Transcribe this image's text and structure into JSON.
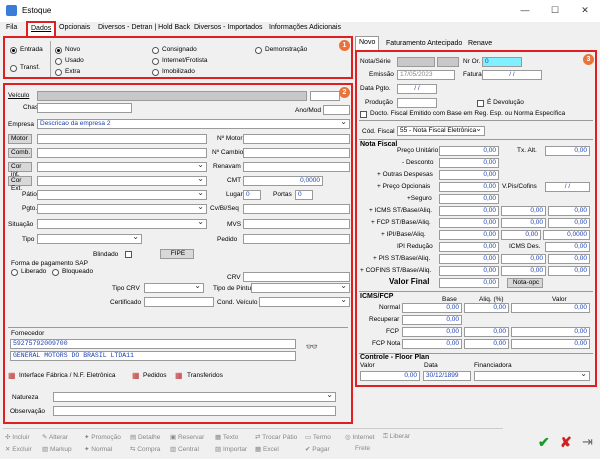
{
  "window": {
    "title": "Estoque",
    "min": "—",
    "max": "☐",
    "close": "✕"
  },
  "tabs": [
    "Fila",
    "Dados",
    "Opcionais",
    "Diversos - Detran | Hold Back",
    "Diversos - Importados",
    "Informações Adicionais"
  ],
  "section1": {
    "badge": "1",
    "entrada": "Entrada",
    "transf": "Transf.",
    "novo": "Novo",
    "usado": "Usado",
    "extra": "Extra",
    "consignado": "Consignado",
    "internet": "Internet/Frotista",
    "imobilizado": "Imobilizado",
    "demonstracao": "Demonstração"
  },
  "section2": {
    "badge": "2",
    "veiculo": "Veículo",
    "chassi": "Chassi",
    "ano_mod": "Ano/Mod",
    "empresa": "Empresa",
    "empresa_val": "Descricao da empresa 2",
    "motor": "Motor",
    "comb": "Comb.",
    "cor_int": "Cor int.",
    "cor_ext": "Cor Ext.",
    "patio": "Pátio",
    "pgto": "Pgto.",
    "situacao": "Situação",
    "tipo": "Tipo",
    "n_motor": "Nº Motor",
    "n_cambio": "Nº Cambio",
    "renavam": "Renavam",
    "cmt": "CMT",
    "cmt_val": "0,0000",
    "lugar": "Lugar",
    "lugar_val": "0",
    "portas": "Portas",
    "portas_val": "0",
    "cv_bi_seq": "Cv/Bi/Seq",
    "mvs": "MVS",
    "pedido": "Pedido",
    "blindado": "Blindado",
    "fipe": "FIPE",
    "forma_pgto": "Forma de pagamento SAP",
    "liberado": "Liberado",
    "bloqueado": "Bloqueado",
    "crv": "CRV",
    "tipo_crv": "Tipo CRV",
    "tipo_pintura": "Tipo de Pintura",
    "certificado": "Certificado",
    "cond_veiculo": "Cond. Veículo",
    "fornecedor": "Fornecedor",
    "forn_cod": "59275792009700",
    "forn_nome": "GENERAL MOTORS DO BRASIL LTDA11",
    "int_fabrica": "Interface Fábrica / N.F. Eletrônica",
    "pedidos": "Pedidos",
    "transferidos": "Transferidos",
    "natureza": "Natureza",
    "observacao": "Observação"
  },
  "right_tabs": [
    "Novo",
    "Faturamento Antecipado",
    "Renave"
  ],
  "section3": {
    "badge": "3",
    "nota_serie": "Nota/Série",
    "nr_or": "Nr Or.",
    "nr_or_val": "0",
    "emissao": "Emissão",
    "emissao_val": "17/05/2023",
    "fatura": "Fatura",
    "fatura_val": "/ /",
    "data_pgto": "Data Pgto.",
    "data_pgto_val": "/ /",
    "producao": "Produção",
    "e_devolucao": "É Devolução",
    "docto": "Docto. Fiscal Emitido com Base em Reg. Esp. ou Norma Específica",
    "cod_fiscal": "Cód. Fiscal",
    "cod_fiscal_val": "55 - Nota Fiscal Eletrônica",
    "nota_fiscal": "Nota Fiscal",
    "preco_unit": "Preço Unitário",
    "desconto": "- Desconto",
    "outras": "+ Outras Despesas",
    "preco_op": "+ Preço Opcionais",
    "seguro": "+Seguro",
    "icms_st": "+ ICMS ST/Base/Aliq.",
    "fcp_st": "+ FCP ST/Base/Aliq.",
    "ipi": "+ IPI/Base/Aliq.",
    "ipi_red": "IPI Redução",
    "pis_st": "+ PIS ST/Base/Aliq.",
    "cofins_st": "+ COFINS ST/Base/Aliq.",
    "valor_final": "Valor Final",
    "tx_alt": "Tx. Alt.",
    "v_pis": "V.Pis/Cofins",
    "v_pis_val": "/ /",
    "icms_des": "ICMS Des.",
    "nota_opc": "Nota-opc",
    "zero": "0,00",
    "zero4": "0,0000",
    "icms_fcp": "ICMS/FCP",
    "base": "Base",
    "aliq": "Aliq. (%)",
    "valor": "Valor",
    "normal": "Normal",
    "recuperar": "Recuperar",
    "fcp": "FCP",
    "fcp_nota": "FCP Nota",
    "floor_plan": "Controle - Floor Plan",
    "fp_valor": "Valor",
    "fp_data": "Data",
    "fp_fin": "Financiadora",
    "fp_data_val": "30/12/1899"
  },
  "toolbar": {
    "row1": [
      "Incluir",
      "Alterar",
      "Promoção",
      "Detalhe",
      "Reservar",
      "Texto",
      "Trocar Pátio",
      "Termo",
      "Internet",
      "Liberar"
    ],
    "row2": [
      "Excluir",
      "Markup",
      "Normal",
      "Compra",
      "Central",
      "Importar",
      "Excel",
      "Pagar",
      "Frete"
    ]
  }
}
